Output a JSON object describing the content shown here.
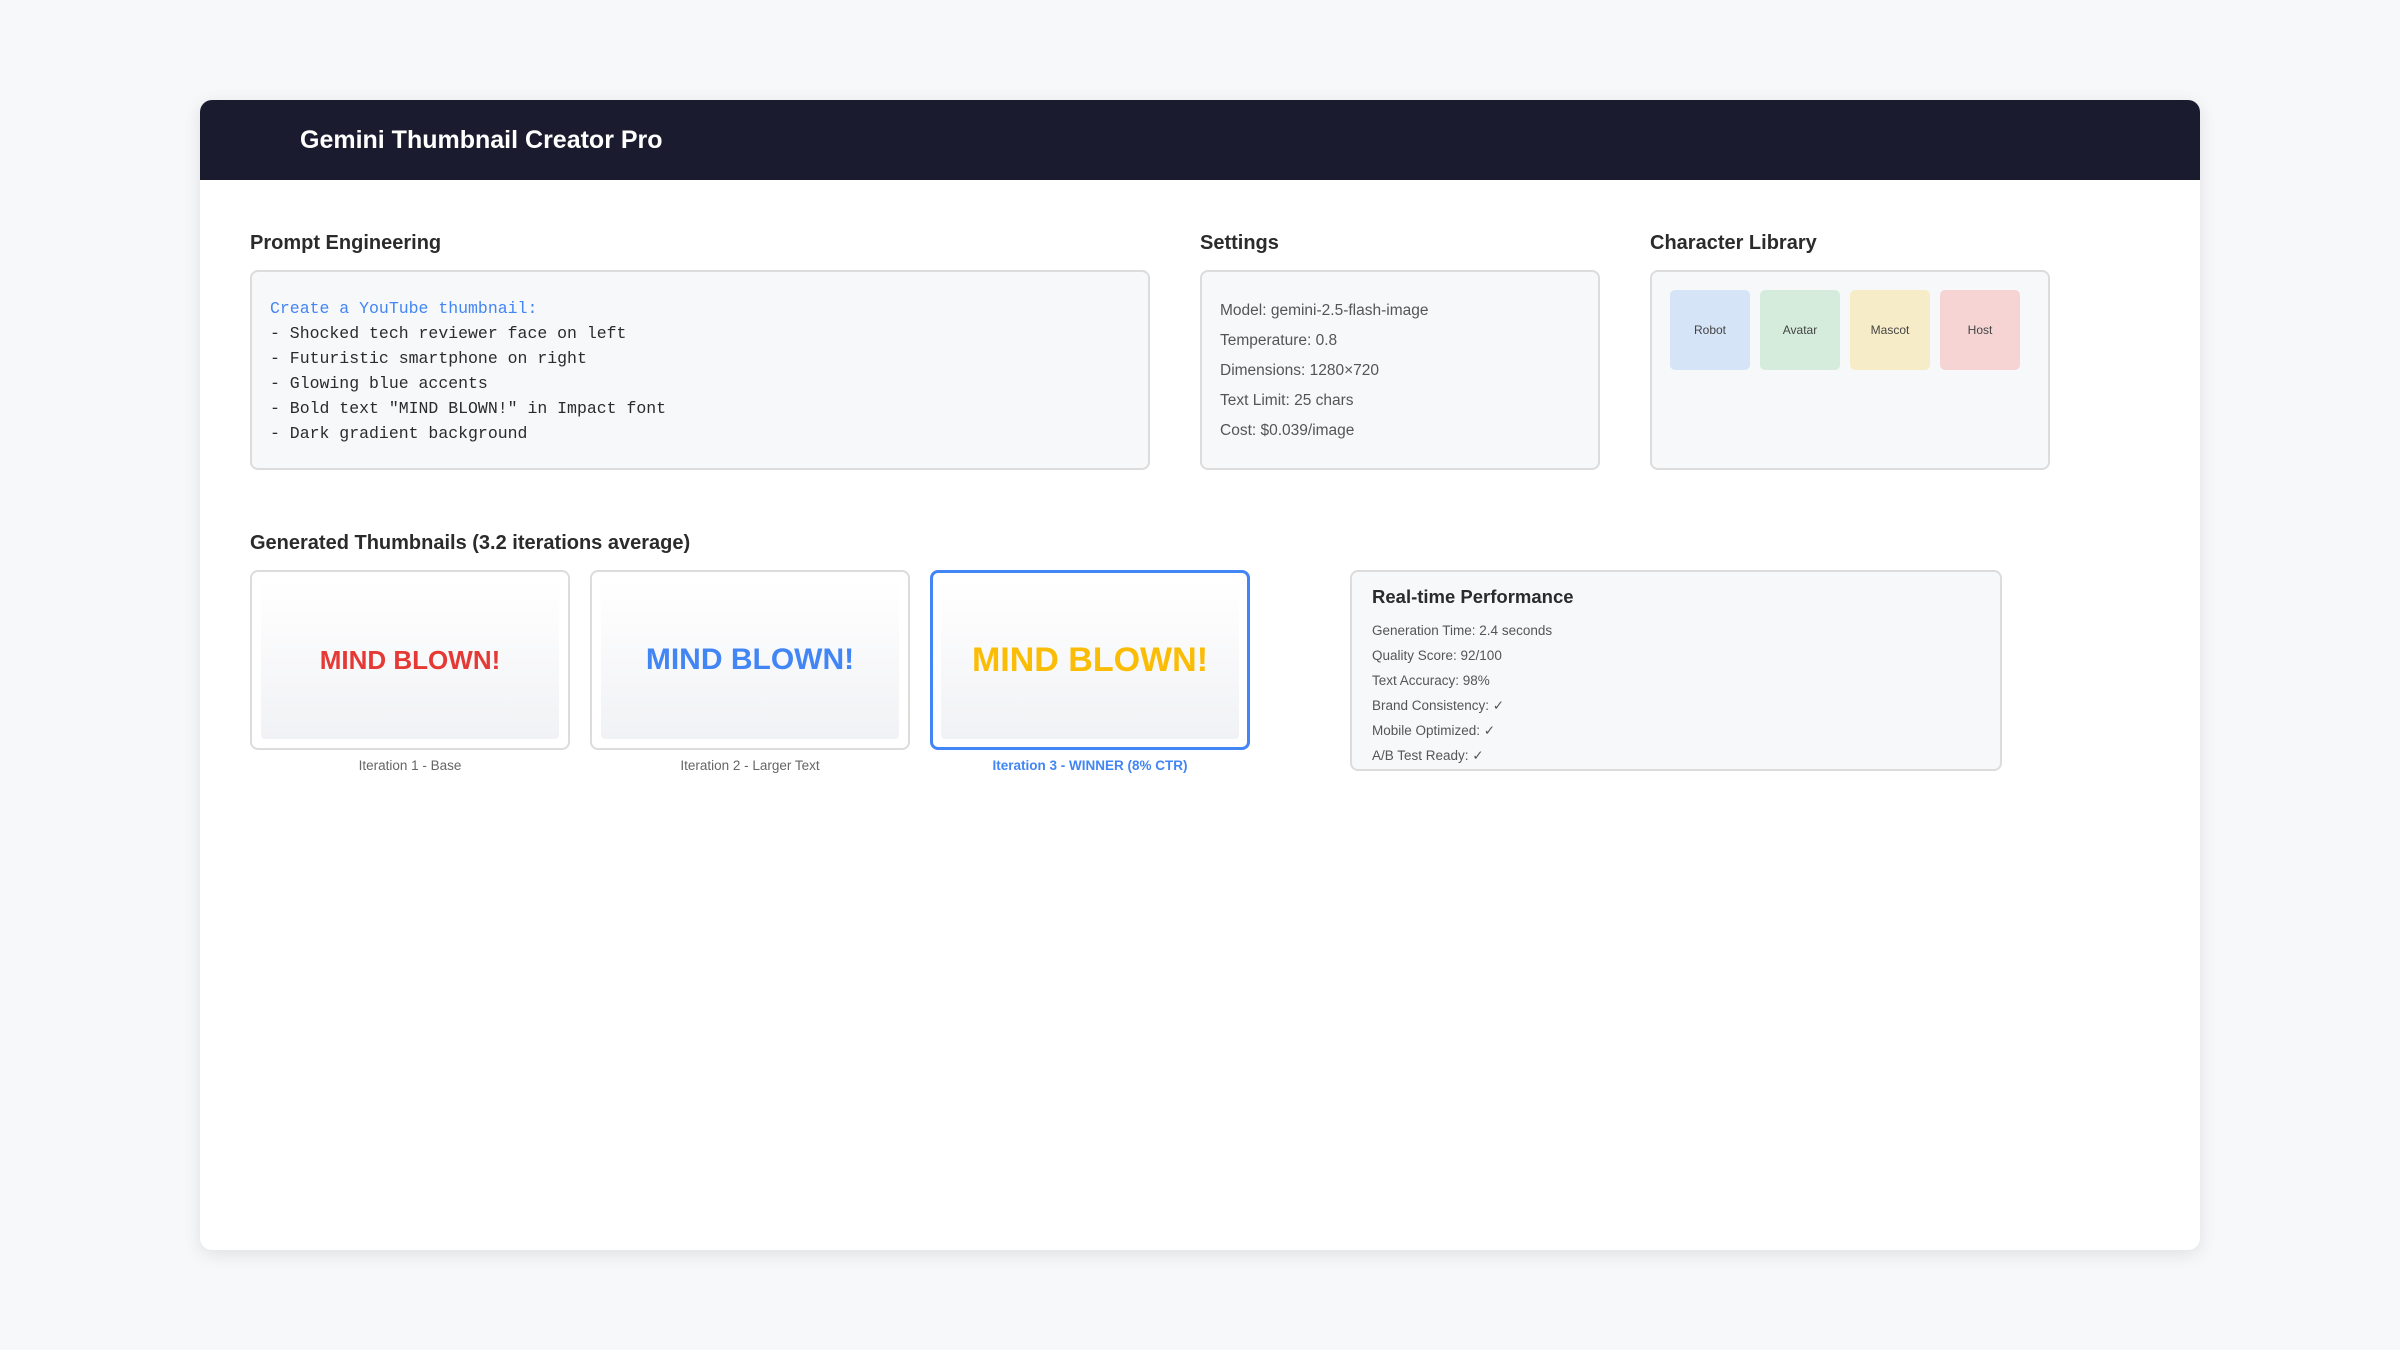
{
  "header": {
    "title": "Gemini Thumbnail Creator Pro",
    "background": "#1a1b2e"
  },
  "prompt_section": {
    "title": "Prompt Engineering",
    "lines": [
      "Create a YouTube thumbnail:",
      "- Shocked tech reviewer face on left",
      "- Futuristic smartphone on right",
      "- Glowing blue accents",
      "- Bold text \"MIND BLOWN!\" in Impact font",
      "- Dark gradient background"
    ],
    "accent_color": "#4285f4"
  },
  "settings_section": {
    "title": "Settings",
    "items": [
      "Model: gemini-2.5-flash-image",
      "Temperature: 0.8",
      "Dimensions: 1280×720",
      "Text Limit: 25 chars",
      "Cost: $0.039/image"
    ]
  },
  "library_section": {
    "title": "Character Library",
    "characters": [
      {
        "label": "Robot",
        "color": "#d6e4f7"
      },
      {
        "label": "Avatar",
        "color": "#d5ecdc"
      },
      {
        "label": "Mascot",
        "color": "#f7ecc8"
      },
      {
        "label": "Host",
        "color": "#f6d4d4"
      }
    ]
  },
  "thumbnails_section": {
    "title": "Generated Thumbnails (3.2 iterations average)",
    "items": [
      {
        "text": "MIND BLOWN!",
        "caption": "Iteration 1 - Base",
        "text_color": "#e53935",
        "winner": false
      },
      {
        "text": "MIND BLOWN!",
        "caption": "Iteration 2 - Larger Text",
        "text_color": "#4285f4",
        "winner": false
      },
      {
        "text": "MIND BLOWN!",
        "caption": "Iteration 3 - WINNER (8% CTR)",
        "text_color": "#fbbc05",
        "winner": true
      }
    ]
  },
  "performance_section": {
    "title": "Real-time Performance",
    "items": [
      "Generation Time: 2.4 seconds",
      "Quality Score: 92/100",
      "Text Accuracy: 98%",
      "Brand Consistency: ✓",
      "Mobile Optimized: ✓",
      "A/B Test Ready: ✓"
    ]
  }
}
